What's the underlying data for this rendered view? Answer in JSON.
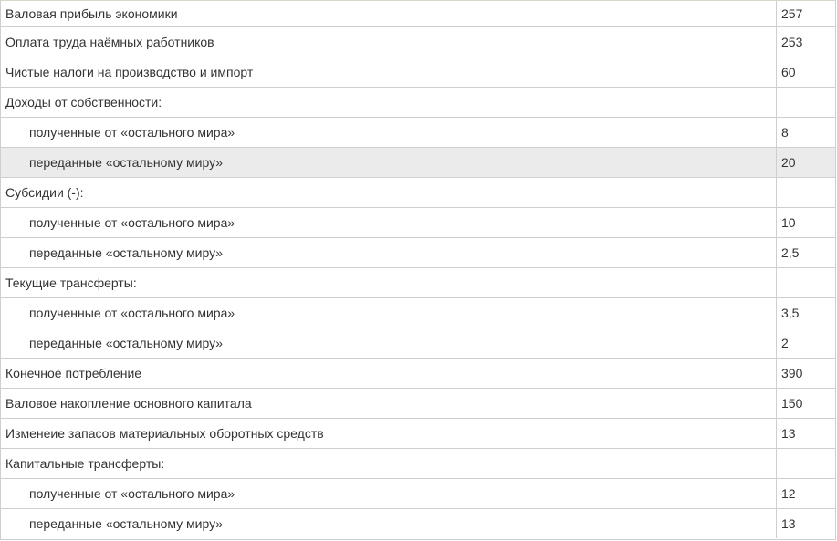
{
  "table": {
    "rows": [
      {
        "label": "Валовая прибыль экономики",
        "value": "257",
        "indent": false,
        "highlight": false
      },
      {
        "label": "Оплата труда наёмных работников",
        "value": "253",
        "indent": false,
        "highlight": false
      },
      {
        "label": "Чистые налоги на производство и импорт",
        "value": "60",
        "indent": false,
        "highlight": false
      },
      {
        "label": "Доходы от собственности:",
        "value": "",
        "indent": false,
        "highlight": false
      },
      {
        "label": "полученные от «остального мира»",
        "value": "8",
        "indent": true,
        "highlight": false
      },
      {
        "label": "переданные «остальному миру»",
        "value": "20",
        "indent": true,
        "highlight": true
      },
      {
        "label": "Субсидии (-):",
        "value": "",
        "indent": false,
        "highlight": false
      },
      {
        "label": "полученные от «остального мира»",
        "value": "10",
        "indent": true,
        "highlight": false
      },
      {
        "label": "переданные «остальному миру»",
        "value": "2,5",
        "indent": true,
        "highlight": false
      },
      {
        "label": "Текущие трансферты:",
        "value": "",
        "indent": false,
        "highlight": false
      },
      {
        "label": "полученные от «остального мира»",
        "value": "3,5",
        "indent": true,
        "highlight": false
      },
      {
        "label": "переданные «остальному миру»",
        "value": "2",
        "indent": true,
        "highlight": false
      },
      {
        "label": "Конечное потребление",
        "value": "390",
        "indent": false,
        "highlight": false
      },
      {
        "label": "Валовое накопление основного капитала",
        "value": "150",
        "indent": false,
        "highlight": false
      },
      {
        "label": "Изменеие запасов материальных оборотных средств",
        "value": "13",
        "indent": false,
        "highlight": false
      },
      {
        "label": "Капитальные трансферты:",
        "value": "",
        "indent": false,
        "highlight": false
      },
      {
        "label": "полученные от «остального мира»",
        "value": "12",
        "indent": true,
        "highlight": false
      },
      {
        "label": "переданные «остальному миру»",
        "value": "13",
        "indent": true,
        "highlight": false
      }
    ]
  }
}
